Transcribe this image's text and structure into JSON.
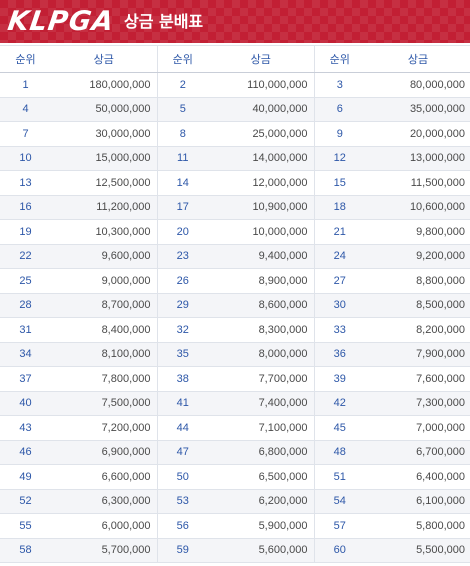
{
  "header": {
    "logo_text": "KLPGA",
    "title": "상금 분배표"
  },
  "table": {
    "columns": [
      "순위",
      "상금",
      "순위",
      "상금",
      "순위",
      "상금"
    ],
    "rows": [
      [
        [
          "1",
          "180,000,000"
        ],
        [
          "2",
          "110,000,000"
        ],
        [
          "3",
          "80,000,000"
        ]
      ],
      [
        [
          "4",
          "50,000,000"
        ],
        [
          "5",
          "40,000,000"
        ],
        [
          "6",
          "35,000,000"
        ]
      ],
      [
        [
          "7",
          "30,000,000"
        ],
        [
          "8",
          "25,000,000"
        ],
        [
          "9",
          "20,000,000"
        ]
      ],
      [
        [
          "10",
          "15,000,000"
        ],
        [
          "11",
          "14,000,000"
        ],
        [
          "12",
          "13,000,000"
        ]
      ],
      [
        [
          "13",
          "12,500,000"
        ],
        [
          "14",
          "12,000,000"
        ],
        [
          "15",
          "11,500,000"
        ]
      ],
      [
        [
          "16",
          "11,200,000"
        ],
        [
          "17",
          "10,900,000"
        ],
        [
          "18",
          "10,600,000"
        ]
      ],
      [
        [
          "19",
          "10,300,000"
        ],
        [
          "20",
          "10,000,000"
        ],
        [
          "21",
          "9,800,000"
        ]
      ],
      [
        [
          "22",
          "9,600,000"
        ],
        [
          "23",
          "9,400,000"
        ],
        [
          "24",
          "9,200,000"
        ]
      ],
      [
        [
          "25",
          "9,000,000"
        ],
        [
          "26",
          "8,900,000"
        ],
        [
          "27",
          "8,800,000"
        ]
      ],
      [
        [
          "28",
          "8,700,000"
        ],
        [
          "29",
          "8,600,000"
        ],
        [
          "30",
          "8,500,000"
        ]
      ],
      [
        [
          "31",
          "8,400,000"
        ],
        [
          "32",
          "8,300,000"
        ],
        [
          "33",
          "8,200,000"
        ]
      ],
      [
        [
          "34",
          "8,100,000"
        ],
        [
          "35",
          "8,000,000"
        ],
        [
          "36",
          "7,900,000"
        ]
      ],
      [
        [
          "37",
          "7,800,000"
        ],
        [
          "38",
          "7,700,000"
        ],
        [
          "39",
          "7,600,000"
        ]
      ],
      [
        [
          "40",
          "7,500,000"
        ],
        [
          "41",
          "7,400,000"
        ],
        [
          "42",
          "7,300,000"
        ]
      ],
      [
        [
          "43",
          "7,200,000"
        ],
        [
          "44",
          "7,100,000"
        ],
        [
          "45",
          "7,000,000"
        ]
      ],
      [
        [
          "46",
          "6,900,000"
        ],
        [
          "47",
          "6,800,000"
        ],
        [
          "48",
          "6,700,000"
        ]
      ],
      [
        [
          "49",
          "6,600,000"
        ],
        [
          "50",
          "6,500,000"
        ],
        [
          "51",
          "6,400,000"
        ]
      ],
      [
        [
          "52",
          "6,300,000"
        ],
        [
          "53",
          "6,200,000"
        ],
        [
          "54",
          "6,100,000"
        ]
      ],
      [
        [
          "55",
          "6,000,000"
        ],
        [
          "56",
          "5,900,000"
        ],
        [
          "57",
          "5,800,000"
        ]
      ],
      [
        [
          "58",
          "5,700,000"
        ],
        [
          "59",
          "5,600,000"
        ],
        [
          "60",
          "5,500,000"
        ]
      ]
    ]
  },
  "colors": {
    "header_red": "#c21f34",
    "rank_blue": "#2d57a8",
    "prize_gray": "#4a4a4a",
    "stripe": "#f4f5f8"
  }
}
